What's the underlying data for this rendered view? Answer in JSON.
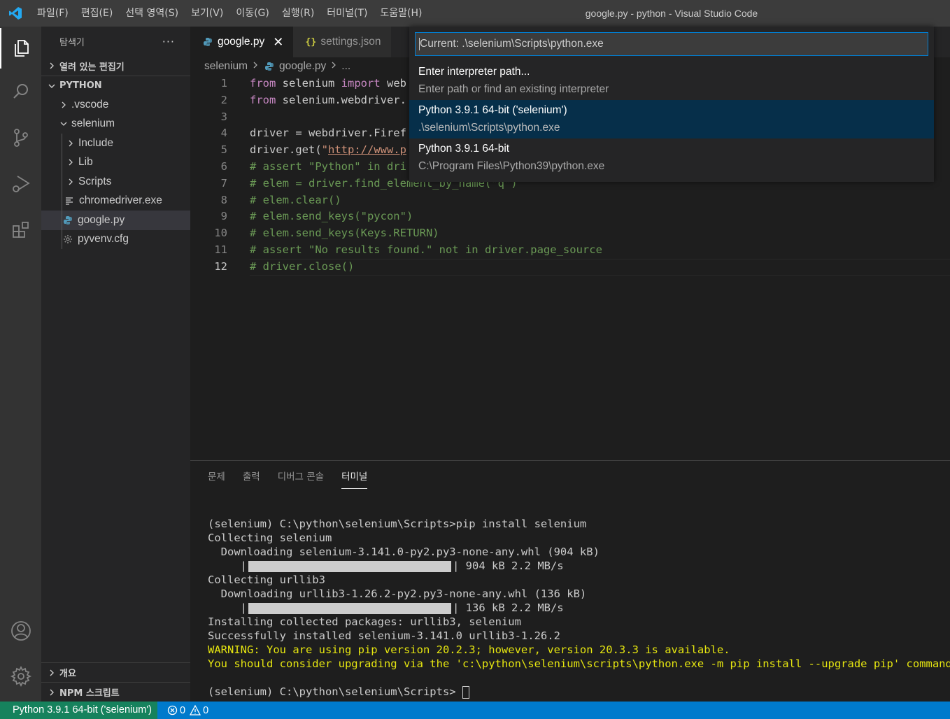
{
  "titlebar": {
    "logo_icon": "vscode-logo",
    "menu": [
      "파일(F)",
      "편집(E)",
      "선택 영역(S)",
      "보기(V)",
      "이동(G)",
      "실행(R)",
      "터미널(T)",
      "도움말(H)"
    ],
    "window_title": "google.py - python - Visual Studio Code"
  },
  "activitybar": {
    "items": [
      "explorer-icon",
      "search-icon",
      "source-control-icon",
      "run-debug-icon",
      "extensions-icon"
    ],
    "bottom": [
      "accounts-icon",
      "settings-gear-icon"
    ]
  },
  "sidebar": {
    "title": "탐색기",
    "more": "···",
    "open_editors": "열려 있는 편집기",
    "workspace": "PYTHON",
    "tree": [
      {
        "label": ".vscode",
        "type": "folder",
        "expanded": false
      },
      {
        "label": "selenium",
        "type": "folder",
        "expanded": true
      },
      {
        "label": "Include",
        "type": "folder",
        "expanded": false
      },
      {
        "label": "Lib",
        "type": "folder",
        "expanded": false
      },
      {
        "label": "Scripts",
        "type": "folder",
        "expanded": false
      },
      {
        "label": "chromedriver.exe",
        "type": "file",
        "icon": "text-lines-icon"
      },
      {
        "label": "google.py",
        "type": "file",
        "icon": "python-icon",
        "selected": true
      },
      {
        "label": "pyvenv.cfg",
        "type": "file",
        "icon": "gear-icon"
      }
    ],
    "outline": "개요",
    "npm_scripts": "NPM 스크립트"
  },
  "tabs": [
    {
      "label": "google.py",
      "icon": "python-icon",
      "active": true,
      "close": "✕"
    },
    {
      "label": "settings.json",
      "icon": "json-braces-icon",
      "active": false
    }
  ],
  "breadcrumb": {
    "parts": [
      "selenium",
      "google.py",
      "..."
    ]
  },
  "editor": {
    "current_line": 12,
    "line_numbers": [
      "1",
      "2",
      "3",
      "4",
      "5",
      "6",
      "7",
      "8",
      "9",
      "10",
      "11",
      "12"
    ],
    "lines": [
      [
        {
          "t": "kw",
          "v": "from"
        },
        {
          "t": "p",
          "v": " selenium "
        },
        {
          "t": "kw",
          "v": "import"
        },
        {
          "t": "p",
          "v": " web"
        }
      ],
      [
        {
          "t": "kw",
          "v": "from"
        },
        {
          "t": "p",
          "v": " selenium.webdriver."
        }
      ],
      [],
      [
        {
          "t": "p",
          "v": "driver = webdriver.Firef"
        }
      ],
      [
        {
          "t": "p",
          "v": "driver.get("
        },
        {
          "t": "str",
          "v": "\""
        },
        {
          "t": "url",
          "v": "http://www.p"
        }
      ],
      [
        {
          "t": "cm",
          "v": "# assert \"Python\" in dri"
        }
      ],
      [
        {
          "t": "cm",
          "v": "# elem = driver.find_element_by_name(\"q\")"
        }
      ],
      [
        {
          "t": "cm",
          "v": "# elem.clear()"
        }
      ],
      [
        {
          "t": "cm",
          "v": "# elem.send_keys(\"pycon\")"
        }
      ],
      [
        {
          "t": "cm",
          "v": "# elem.send_keys(Keys.RETURN)"
        }
      ],
      [
        {
          "t": "cm",
          "v": "# assert \"No results found.\" not in driver.page_source"
        }
      ],
      [
        {
          "t": "cm",
          "v": "# driver.close()"
        }
      ]
    ]
  },
  "quickpick": {
    "input_value": "Current: .\\selenium\\Scripts\\python.exe",
    "items": [
      {
        "label": "Enter interpreter path...",
        "description": "Enter path or find an existing interpreter",
        "selected": false
      },
      {
        "label": "Python 3.9.1 64-bit ('selenium')",
        "description": ".\\selenium\\Scripts\\python.exe",
        "selected": true
      },
      {
        "label": "Python 3.9.1 64-bit",
        "description": "C:\\Program Files\\Python39\\python.exe",
        "selected": false
      }
    ]
  },
  "panel": {
    "tabs": [
      "문제",
      "출력",
      "디버그 콘솔",
      "터미널"
    ],
    "active_tab": "터미널",
    "terminal_lines": [
      {
        "text": "(selenium) C:\\python\\selenium\\Scripts>pip install selenium"
      },
      {
        "text": "Collecting selenium"
      },
      {
        "text": "  Downloading selenium-3.141.0-py2.py3-none-any.whl (904 kB)"
      },
      {
        "progress": 1.0,
        "prefix": "     |",
        "suffix": "| 904 kB 2.2 MB/s"
      },
      {
        "text": "Collecting urllib3"
      },
      {
        "text": "  Downloading urllib3-1.26.2-py2.py3-none-any.whl (136 kB)"
      },
      {
        "progress": 1.0,
        "prefix": "     |",
        "suffix": "| 136 kB 2.2 MB/s"
      },
      {
        "text": "Installing collected packages: urllib3, selenium"
      },
      {
        "text": "Successfully installed selenium-3.141.0 urllib3-1.26.2"
      },
      {
        "text": "WARNING: You are using pip version 20.2.3; however, version 20.3.3 is available.",
        "warn": true
      },
      {
        "text": "You should consider upgrading via the 'c:\\python\\selenium\\scripts\\python.exe -m pip install --upgrade pip' command.",
        "warn": true
      },
      {
        "text": ""
      },
      {
        "text": "(selenium) C:\\python\\selenium\\Scripts> ",
        "cursor": true
      }
    ]
  },
  "statusbar": {
    "interpreter": "Python 3.9.1 64-bit ('selenium')",
    "errors": "0",
    "warnings": "0"
  },
  "colors": {
    "accent": "#007acc",
    "interpreter_bg": "#16825d",
    "selection": "#062f4a",
    "keyword": "#c586c0",
    "string": "#ce9178",
    "comment": "#6a9955",
    "warning_text": "#e5e510"
  }
}
